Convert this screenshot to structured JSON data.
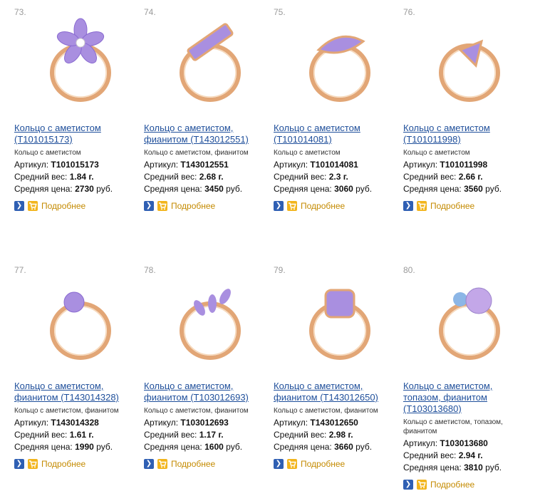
{
  "labels": {
    "article": "Артикул:",
    "weight": "Средний вес:",
    "price": "Средняя цена:",
    "weight_unit": "г.",
    "price_unit": "руб.",
    "more": "Подробнее"
  },
  "colors": {
    "link": "#1f4f9b",
    "more": "#c48a00",
    "gold": "#e2a676",
    "amethyst": "#a98fe0",
    "go_button": "#2f5fb3",
    "cart_button": "#f2b51d"
  },
  "products": [
    {
      "num": "73.",
      "title_line1": "Кольцо с аметистом",
      "title_line2": "(Т101015173)",
      "subtitle": "Кольцо с аметистом",
      "subtitle2": "",
      "article": "Т101015173",
      "weight": "1.84",
      "price": "2730",
      "icon": "flower-ring"
    },
    {
      "num": "74.",
      "title_line1": "Кольцо с аметистом,",
      "title_line2": "фианитом (Т143012551)",
      "subtitle": "Кольцо с аметистом, фианитом",
      "subtitle2": "",
      "article": "Т143012551",
      "weight": "2.68",
      "price": "3450",
      "icon": "baguette-ring"
    },
    {
      "num": "75.",
      "title_line1": "Кольцо с аметистом",
      "title_line2": "(Т101014081)",
      "subtitle": "Кольцо с аметистом",
      "subtitle2": "",
      "article": "Т101014081",
      "weight": "2.3",
      "price": "3060",
      "icon": "marquise-ring"
    },
    {
      "num": "76.",
      "title_line1": "Кольцо с аметистом",
      "title_line2": "(Т101011998)",
      "subtitle": "Кольцо с аметистом",
      "subtitle2": "",
      "article": "Т101011998",
      "weight": "2.66",
      "price": "3560",
      "icon": "trillion-ring"
    },
    {
      "num": "77.",
      "title_line1": "Кольцо с аметистом,",
      "title_line2": "фианитом (Т143014328)",
      "subtitle": "Кольцо с аметистом, фианитом",
      "subtitle2": "",
      "article": "Т143014328",
      "weight": "1.61",
      "price": "1990",
      "icon": "round-ring"
    },
    {
      "num": "78.",
      "title_line1": "Кольцо с аметистом,",
      "title_line2": "фианитом (Т103012693)",
      "subtitle": "Кольцо с аметистом, фианитом",
      "subtitle2": "",
      "article": "Т103012693",
      "weight": "1.17",
      "price": "1600",
      "icon": "leaf-ring"
    },
    {
      "num": "79.",
      "title_line1": "Кольцо с аметистом,",
      "title_line2": "фианитом (Т143012650)",
      "subtitle": "Кольцо с аметистом, фианитом",
      "subtitle2": "",
      "article": "Т143012650",
      "weight": "2.98",
      "price": "3660",
      "icon": "cushion-ring"
    },
    {
      "num": "80.",
      "title_line1": "Кольцо с аметистом,",
      "title_line2": "топазом, фианитом",
      "title_line3": "(Т103013680)",
      "subtitle": "Кольцо с аметистом, топазом,",
      "subtitle2": "фианитом",
      "article": "Т103013680",
      "weight": "2.94",
      "price": "3810",
      "icon": "cabochon-ring"
    }
  ]
}
